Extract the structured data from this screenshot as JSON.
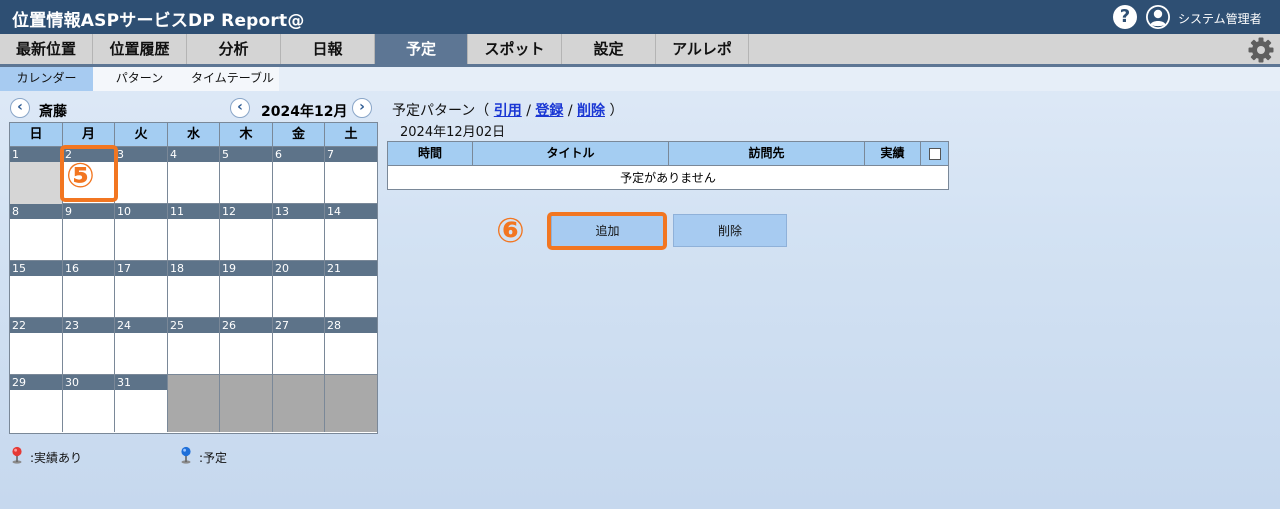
{
  "header": {
    "title": "位置情報ASPサービスDP Report@",
    "help_icon": "question-circle-icon",
    "user_icon": "user-circle-icon",
    "user_name": "システム管理者"
  },
  "nav": {
    "items": [
      "最新位置",
      "位置履歴",
      "分析",
      "日報",
      "予定",
      "スポット",
      "設定",
      "アルレポ"
    ],
    "active": "予定",
    "settings_icon": "gear-icon"
  },
  "subnav": {
    "items": [
      "カレンダー",
      "パターン",
      "タイムテーブル"
    ],
    "active": "カレンダー"
  },
  "calendar": {
    "prev_icon": "‹",
    "next_icon": "›",
    "user": "斎藤",
    "month": "2024年12月",
    "weekdays": [
      "日",
      "月",
      "火",
      "水",
      "木",
      "金",
      "土"
    ],
    "weeks": [
      [
        "1",
        "2",
        "3",
        "4",
        "5",
        "6",
        "7"
      ],
      [
        "8",
        "9",
        "10",
        "11",
        "12",
        "13",
        "14"
      ],
      [
        "15",
        "16",
        "17",
        "18",
        "19",
        "20",
        "21"
      ],
      [
        "22",
        "23",
        "24",
        "25",
        "26",
        "27",
        "28"
      ],
      [
        "29",
        "30",
        "31",
        "",
        "",
        "",
        ""
      ]
    ],
    "selected_day": "2"
  },
  "legend": {
    "actual": ":実績あり",
    "planned": ":予定",
    "actual_color": "#e53935",
    "planned_color": "#1e6fd9"
  },
  "markers": {
    "five": "⑤",
    "six": "⑥",
    "color": "#f27621"
  },
  "schedule": {
    "pattern_label": "予定パターン（",
    "pattern_close": "）",
    "link_quote": "引用",
    "link_register": "登録",
    "link_delete": "削除",
    "separator": "/",
    "selected_date": "2024年12月02日",
    "columns": [
      "時間",
      "タイトル",
      "訪問先",
      "実績"
    ],
    "empty_message": "予定がありません"
  },
  "buttons": {
    "add": "追加",
    "delete": "削除"
  }
}
